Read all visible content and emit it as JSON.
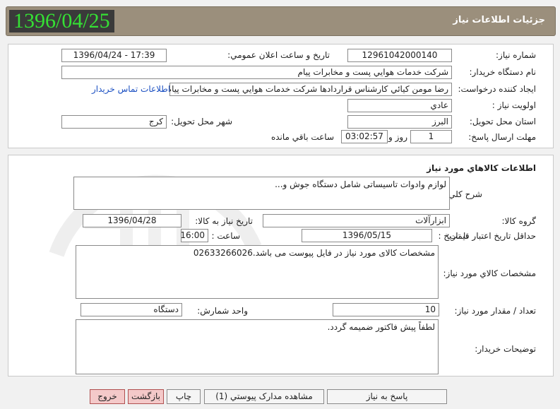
{
  "header": {
    "date": "1396/04/25",
    "title": "جزئيات اطلاعات نياز"
  },
  "info": {
    "need_number_label": "شماره نياز:",
    "need_number": "12961042000140",
    "announce_label": "تاريخ و ساعت اعلان عمومي:",
    "announce_value": "1396/04/24 - 17:39",
    "buyer_org_label": "نام دستگاه خريدار:",
    "buyer_org": "شرکت خدمات هوايي پست و مخابرات پيام",
    "creator_label": "ايجاد کننده درخواست:",
    "creator": "رضا مومن كيائي كارشناس قراردادها شرکت خدمات هوايي پست و مخابرات پيام",
    "contact_link": "اطلاعات تماس خريدار",
    "priority_label": "اولويت نياز :",
    "priority": "عادي",
    "province_label": "استان محل تحويل:",
    "province": "البرز",
    "city_label": "شهر محل تحويل:",
    "city": "کرج",
    "deadline_label": "مهلت ارسال پاسخ:",
    "deadline_days": "1",
    "days_word": "روز و",
    "deadline_time": "03:02:57",
    "remaining_word": "ساعت باقي مانده"
  },
  "goods": {
    "section_title": "اطلاعات کالاهاي مورد نياز",
    "desc_label": "شرح کلي نياز:",
    "desc": "لوازم وادوات تاسيساتی شامل دستگاه جوش و...",
    "group_label": "گروه کالا:",
    "group": "ابزارآلات",
    "need_date_label": "تاريخ نياز به کالا:",
    "need_date": "1396/04/28",
    "min_validity_label": "حداقل تاريخ اعتبار قيمت:",
    "until_date_label": "تا تاريخ :",
    "until_date": "1396/05/15",
    "hour_label": "ساعت :",
    "hour": "16:00",
    "specs_label": "مشخصات کالاي مورد نياز:",
    "specs": "مشخصات کالای مورد نیاز در فایل پیوست می باشد.02633266026",
    "qty_label": "تعداد / مقدار مورد نياز:",
    "qty": "10",
    "unit_label": "واحد شمارش:",
    "unit": "دستگاه",
    "buyer_notes_label": "توضيحات خريدار:",
    "buyer_notes": "لطفاً پیش فاکتور ضمیمه گردد."
  },
  "buttons": {
    "respond": "پاسخ به نياز",
    "attachments": "مشاهده مدارک پيوستي (1)",
    "print": "چاپ",
    "back": "بازگشت",
    "exit": "خروج"
  }
}
